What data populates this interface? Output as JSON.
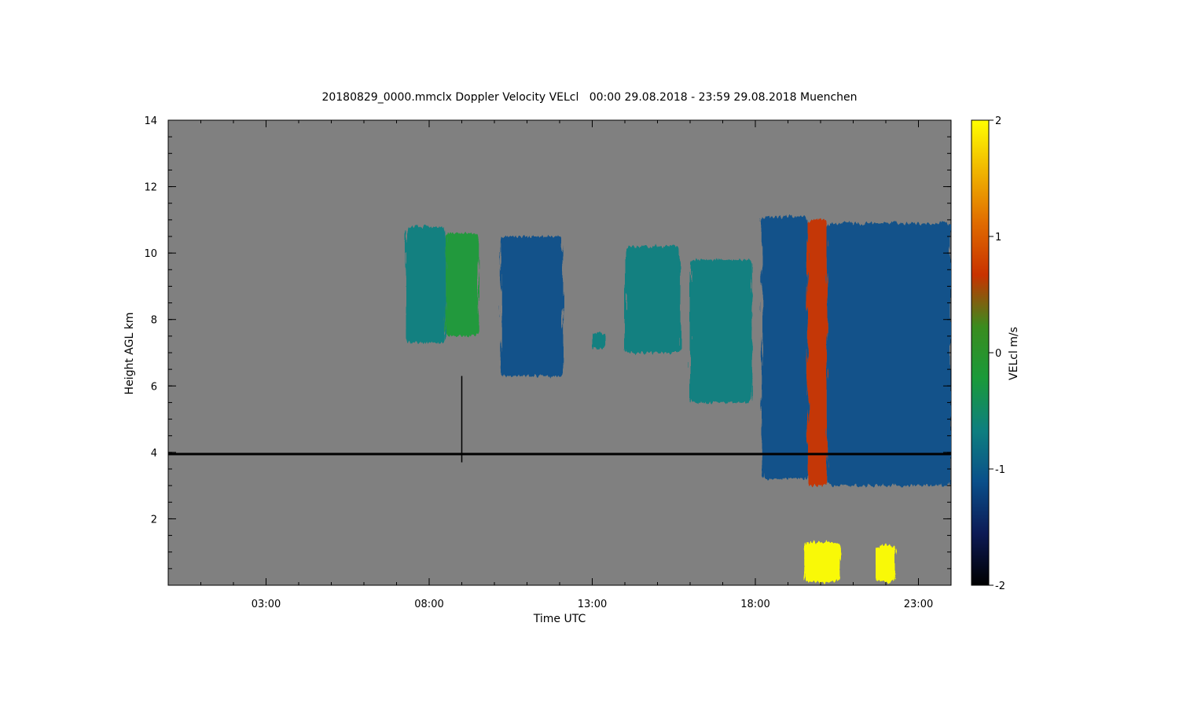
{
  "chart_data": {
    "type": "heatmap",
    "title": "20180829_0000.mmclx Doppler Velocity VELcl   00:00 29.08.2018 - 23:59 29.08.2018 Muenchen",
    "xlabel": "Time UTC",
    "ylabel": "Height AGL km",
    "xlim": [
      0.0,
      24.0
    ],
    "ylim": [
      0.0,
      14.0
    ],
    "x_ticks": [
      3,
      8,
      13,
      18,
      23
    ],
    "x_tick_labels": [
      "03:00",
      "08:00",
      "13:00",
      "18:00",
      "23:00"
    ],
    "y_ticks": [
      2,
      4,
      6,
      8,
      10,
      12,
      14
    ],
    "y_tick_labels": [
      "2",
      "4",
      "6",
      "8",
      "10",
      "12",
      "14"
    ],
    "colorbar": {
      "label": "VELcl m/s",
      "range": [
        -2,
        2
      ],
      "ticks": [
        -2,
        -1,
        0,
        1,
        2
      ],
      "tick_labels": [
        "-2",
        "-1",
        "0",
        "1",
        "2"
      ],
      "colormap": [
        "#000000",
        "#0c1a55",
        "#0a4f8a",
        "#0e7f7f",
        "#1a9a3a",
        "#3a8c1e",
        "#c83200",
        "#e06b00",
        "#f0b400",
        "#ffff00"
      ]
    },
    "background_color": "#808080",
    "echo_regions": [
      {
        "t_start": 7.3,
        "t_end": 8.5,
        "h_bottom": 7.3,
        "h_top": 10.8,
        "mean_velocity": -0.5
      },
      {
        "t_start": 8.5,
        "t_end": 9.5,
        "h_bottom": 7.5,
        "h_top": 10.6,
        "mean_velocity": -0.4
      },
      {
        "t_start": 10.2,
        "t_end": 12.1,
        "h_bottom": 6.3,
        "h_top": 10.5,
        "mean_velocity": -0.9
      },
      {
        "t_start": 13.0,
        "t_end": 13.4,
        "h_bottom": 7.1,
        "h_top": 7.6,
        "mean_velocity": -0.7
      },
      {
        "t_start": 14.0,
        "t_end": 15.7,
        "h_bottom": 7.0,
        "h_top": 10.2,
        "mean_velocity": -0.5
      },
      {
        "t_start": 16.0,
        "t_end": 17.9,
        "h_bottom": 5.5,
        "h_top": 9.8,
        "mean_velocity": -0.7
      },
      {
        "t_start": 18.2,
        "t_end": 19.6,
        "h_bottom": 3.2,
        "h_top": 11.1,
        "mean_velocity": -0.9
      },
      {
        "t_start": 19.6,
        "t_end": 20.2,
        "h_bottom": 3.0,
        "h_top": 11.0,
        "mean_velocity": 0.8
      },
      {
        "t_start": 20.2,
        "t_end": 24.0,
        "h_bottom": 3.0,
        "h_top": 10.9,
        "mean_velocity": -1.1
      },
      {
        "t_start": 19.5,
        "t_end": 20.6,
        "h_bottom": 0.1,
        "h_top": 1.3,
        "mean_velocity": 2.0
      },
      {
        "t_start": 21.7,
        "t_end": 22.3,
        "h_bottom": 0.1,
        "h_top": 1.2,
        "mean_velocity": 2.0
      }
    ],
    "black_line": {
      "height_km": 3.95,
      "spike": {
        "time": 9.0,
        "h_bottom": 3.7,
        "h_top": 6.3
      }
    }
  }
}
